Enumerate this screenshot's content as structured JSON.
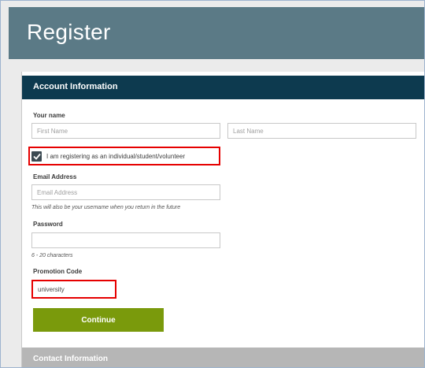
{
  "header": {
    "title": "Register"
  },
  "account": {
    "section_title": "Account Information",
    "name_label": "Your name",
    "first_placeholder": "First Name",
    "last_placeholder": "Last Name",
    "checkbox_label": "I am registering as an individual/student/volunteer",
    "checkbox_checked": true,
    "email_label": "Email Address",
    "email_placeholder": "Email Address",
    "email_hint": "This will also be your username when you return in the future",
    "password_label": "Password",
    "password_hint": "6 - 20 characters",
    "promo_label": "Promotion Code",
    "promo_value": "university",
    "continue_label": "Continue"
  },
  "contact": {
    "section_title": "Contact Information"
  },
  "colors": {
    "header": "#5b7a86",
    "section": "#0d3a4f",
    "button": "#7a9a0c",
    "highlight": "#e60000"
  }
}
